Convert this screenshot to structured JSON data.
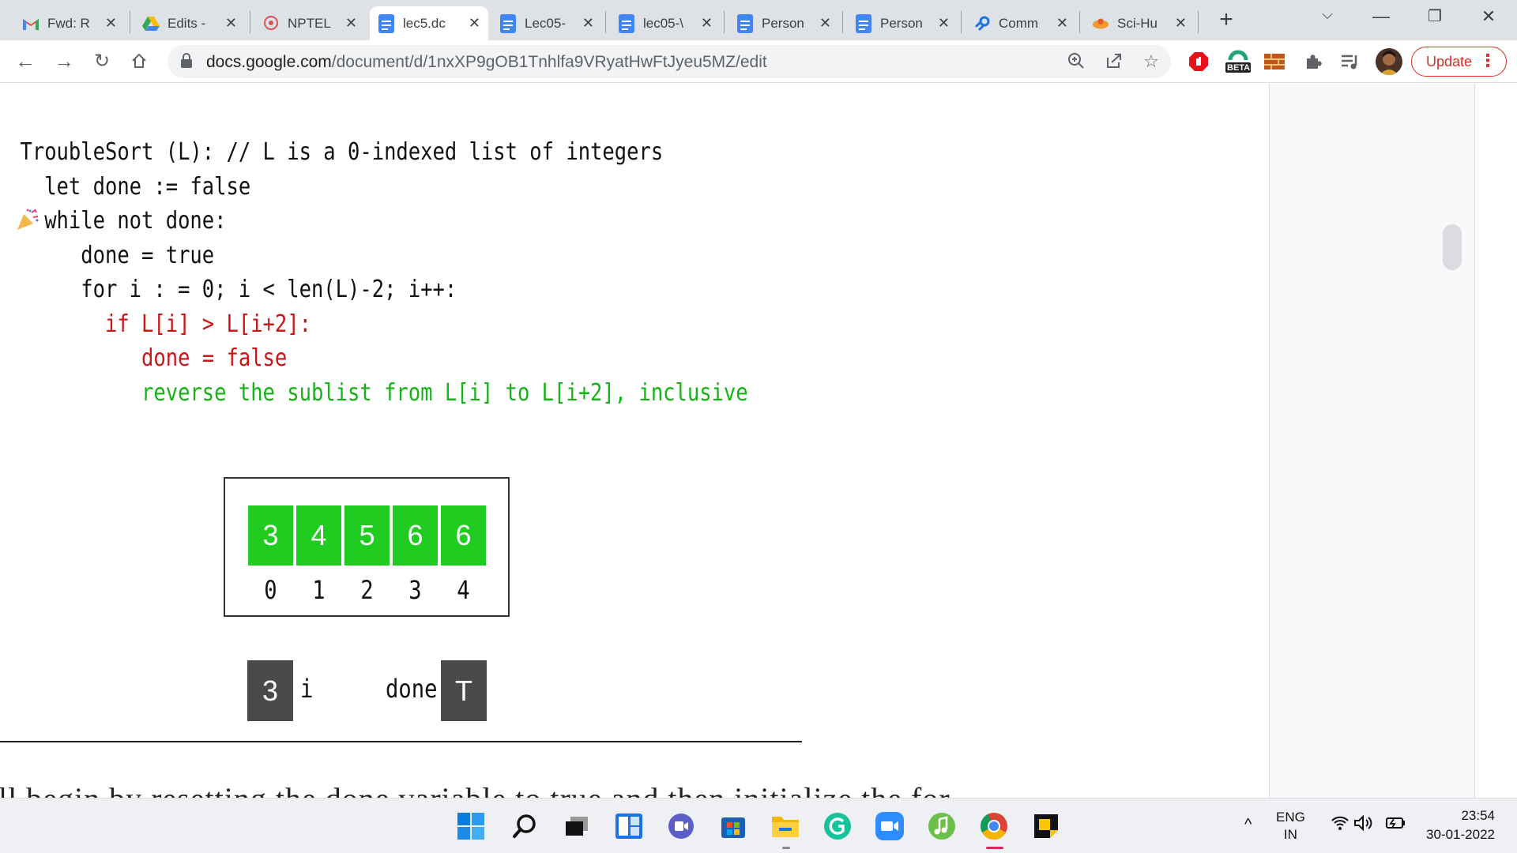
{
  "tabs": [
    {
      "title": "Fwd: R",
      "icon": "gmail-icon"
    },
    {
      "title": "Edits -",
      "icon": "drive-icon"
    },
    {
      "title": "NPTEL",
      "icon": "nptel-icon"
    },
    {
      "title": "lec5.dc",
      "icon": "docs-icon"
    },
    {
      "title": "Lec05-",
      "icon": "docs-icon"
    },
    {
      "title": "lec05-\\",
      "icon": "docs-icon"
    },
    {
      "title": "Person",
      "icon": "docs-icon"
    },
    {
      "title": "Person",
      "icon": "docs-icon"
    },
    {
      "title": "Comm",
      "icon": "link-icon"
    },
    {
      "title": "Sci-Hu",
      "icon": "scihub-icon"
    }
  ],
  "toolbar": {
    "url_domain": "docs.google.com",
    "url_path": "/document/d/1nxXP9gOB1Tnhlfa9VRyatHwFtJyeu5MZ/edit",
    "beta_label": "BETA",
    "update_label": "Update"
  },
  "code": {
    "lines": [
      "TroubleSort (L): // L is a 0-indexed list of integers",
      "  let done := false",
      "  while not done:",
      "     done = true",
      "     for i : = 0; i < len(L)-2; i++:",
      "       if L[i] > L[i+2]:",
      "          done = false",
      "          reverse the sublist from L[i] to L[i+2], inclusive"
    ]
  },
  "array": {
    "values": [
      "3",
      "4",
      "5",
      "6",
      "6"
    ],
    "indices": [
      "0",
      "1",
      "2",
      "3",
      "4"
    ]
  },
  "vars": {
    "i_value": "3",
    "i_label": "i",
    "done_label": "done",
    "done_value": "T"
  },
  "below_text": "ll begin by resetting the done variable to true and then initialize the for",
  "taskbar": {
    "lang_top": "ENG",
    "lang_bottom": "IN",
    "time": "23:54",
    "date": "30-01-2022"
  },
  "colors": {
    "accent_green": "#1fcc1f",
    "code_red": "#cc1515",
    "code_green": "#16b216",
    "var_box": "#4a4a4a"
  }
}
